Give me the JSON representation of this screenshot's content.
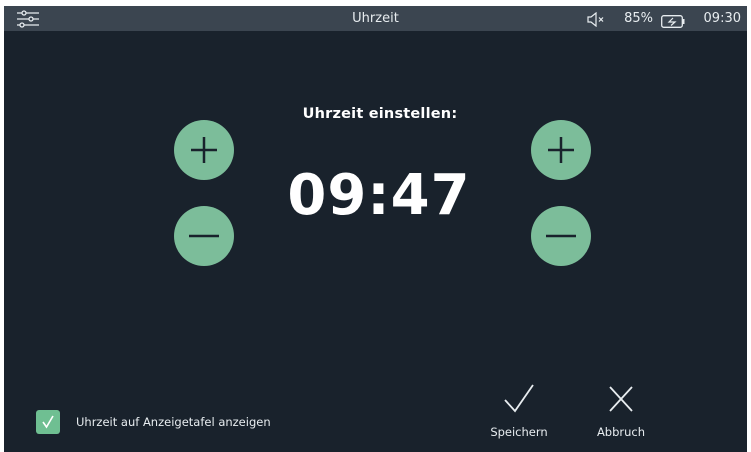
{
  "topbar": {
    "title": "Uhrzeit",
    "battery_percent": "85%",
    "clock": "09:30",
    "icons": [
      "settings-sliders-icon",
      "speaker-muted-icon",
      "battery-icon"
    ]
  },
  "time_setting": {
    "heading": "Uhrzeit einstellen:",
    "time": "09:47",
    "hour_buttons": [
      "plus-icon",
      "minus-icon"
    ],
    "minute_buttons": [
      "plus-icon",
      "minus-icon"
    ]
  },
  "options": {
    "show_on_display_label": "Uhrzeit auf Anzeigetafel anzeigen",
    "show_on_display_checked": true
  },
  "actions": {
    "save_label": "Speichern",
    "cancel_label": "Abbruch"
  },
  "colors": {
    "background": "#19222c",
    "topbar": "#3b4550",
    "accent": "#7cbd9a",
    "text": "#ffffff"
  }
}
